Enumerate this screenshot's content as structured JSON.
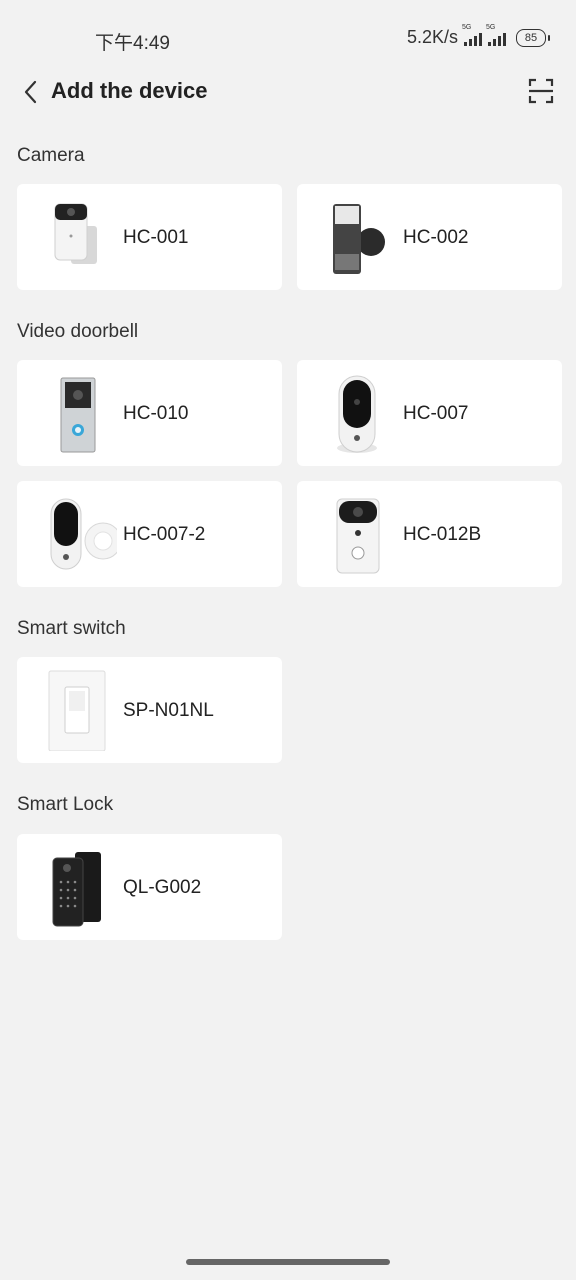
{
  "status_bar": {
    "time": "下午4:49",
    "net_speed": "5.2K/s",
    "signal1_tag": "5G",
    "signal2_tag": "5G",
    "battery": "85"
  },
  "header": {
    "title": "Add the device",
    "back_icon": "chevron-left-icon",
    "scan_icon": "scan-icon"
  },
  "sections": [
    {
      "title": "Camera",
      "devices": [
        {
          "name": "HC-001"
        },
        {
          "name": "HC-002"
        }
      ]
    },
    {
      "title": "Video doorbell",
      "devices": [
        {
          "name": "HC-010"
        },
        {
          "name": "HC-007"
        },
        {
          "name": "HC-007-2"
        },
        {
          "name": "HC-012B"
        }
      ]
    },
    {
      "title": "Smart switch",
      "devices": [
        {
          "name": "SP-N01NL"
        }
      ]
    },
    {
      "title": "Smart Lock",
      "devices": [
        {
          "name": "QL-G002"
        }
      ]
    }
  ],
  "colors": {
    "background": "#f2f2f2",
    "card": "#ffffff",
    "text": "#222222"
  }
}
